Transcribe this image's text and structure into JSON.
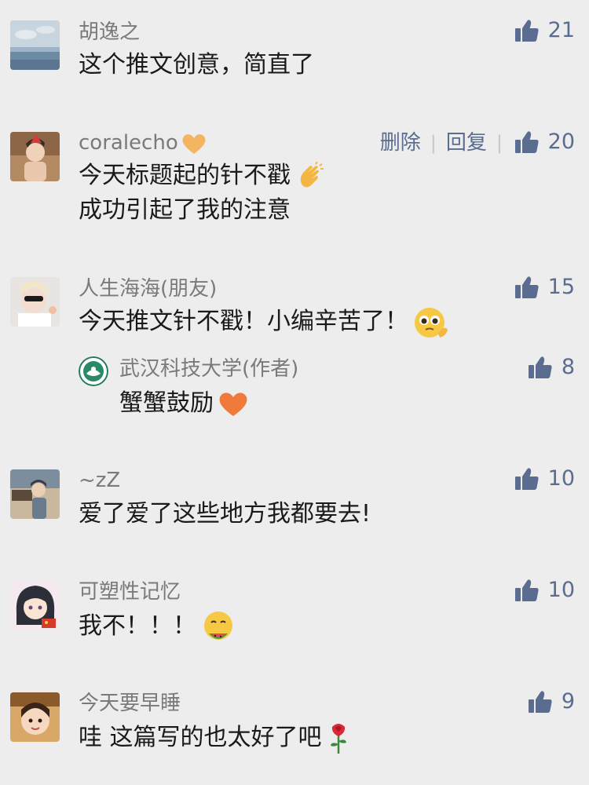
{
  "comments": [
    {
      "name": "胡逸之",
      "lines": [
        "这个推文创意，简直了"
      ],
      "likes": "21"
    },
    {
      "name": "coralecho",
      "name_icon": "orange-heart-icon",
      "actions": {
        "delete": "删除",
        "reply": "回复"
      },
      "lines": [
        "今天标题起的针不戳",
        "成功引起了我的注意"
      ],
      "line1_emoji": "clapping-hands-icon",
      "likes": "20"
    },
    {
      "name": "人生海海(朋友)",
      "lines": [
        "今天推文针不戳！小编辛苦了！"
      ],
      "emoji": "pleading-face-icon",
      "likes": "15",
      "reply": {
        "name": "武汉科技大学(作者)",
        "text": "蟹蟹鼓励",
        "emoji": "orange-heart-icon",
        "likes": "8"
      }
    },
    {
      "name": "~zZ",
      "lines": [
        "爱了爱了这些地方我都要去!"
      ],
      "likes": "10"
    },
    {
      "name": "可塑性记忆",
      "lines": [
        "我不！！！"
      ],
      "emoji": "eating-watermelon-face-icon",
      "likes": "10"
    },
    {
      "name": "今天要早睡",
      "lines": [
        "哇 这篇写的也太好了吧"
      ],
      "emoji": "rose-icon",
      "likes": "9"
    }
  ],
  "colors": {
    "background": "#ededed",
    "name": "#7a7a7a",
    "text": "#1a1a1a",
    "like_blue": "#5a6c8f",
    "heart_orange": "#f0a742"
  }
}
